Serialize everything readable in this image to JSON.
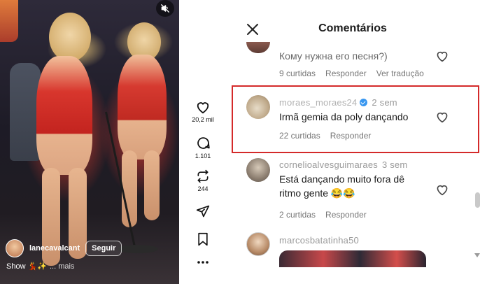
{
  "video": {
    "author_name": "lanecavalcant",
    "follow_label": "Seguir",
    "caption_text": "Show 💃✨",
    "caption_more": "... mais"
  },
  "actions": {
    "likes_count": "20,2 mil",
    "comments_count": "1.101",
    "reposts_count": "244"
  },
  "panel": {
    "title": "Comentários"
  },
  "comments": [
    {
      "text": "Кому нужна его песня?)",
      "likes": "9 curtidas",
      "reply": "Responder",
      "translate": "Ver tradução"
    },
    {
      "username": "moraes_moraes24",
      "time": "2 sem",
      "text": "Irmã gemia da poly dançando",
      "likes": "22 curtidas",
      "reply": "Responder"
    },
    {
      "username": "cornelioalvesguimaraes",
      "time": "3 sem",
      "text": "Está dançando muito fora dê ritmo gente 😂😂",
      "likes": "2 curtidas",
      "reply": "Responder"
    },
    {
      "username": "marcosbatatinha50"
    }
  ],
  "colors": {
    "highlight": "#d42a2a",
    "verified": "#3897f0"
  }
}
